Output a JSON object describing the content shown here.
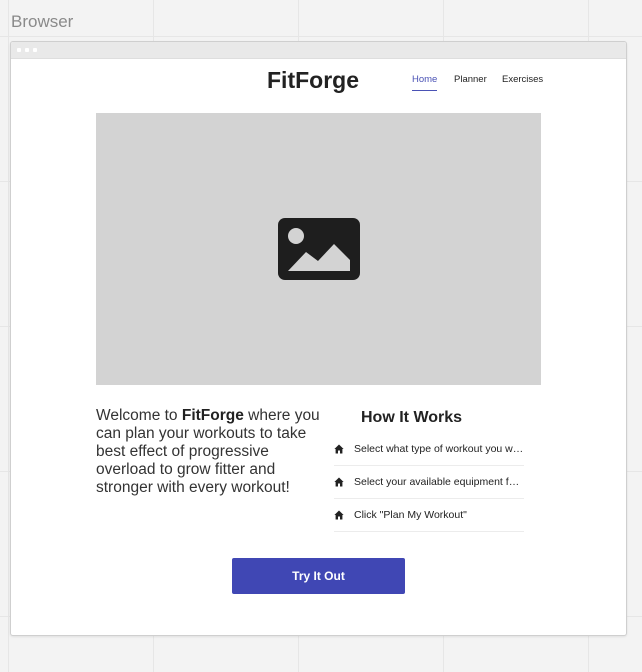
{
  "canvas": {
    "label": "Browser"
  },
  "header": {
    "brand": "FitForge",
    "nav": [
      {
        "label": "Home",
        "active": true
      },
      {
        "label": "Planner",
        "active": false
      },
      {
        "label": "Exercises",
        "active": false
      }
    ]
  },
  "hero": {
    "icon": "image-placeholder-icon"
  },
  "intro": {
    "prefix": "Welcome to ",
    "brand": "FitForge",
    "suffix": " where you can plan your workouts to take best effect of progressive overload to grow fitter and stronger with every workout!"
  },
  "how_it_works": {
    "title": "How It Works",
    "steps": [
      {
        "icon": "home-icon",
        "text": "Select what type of workout you would like"
      },
      {
        "icon": "home-icon",
        "text": "Select your available equipment for the workout"
      },
      {
        "icon": "home-icon",
        "text": "Click \"Plan My Workout\""
      }
    ]
  },
  "cta": {
    "label": "Try It Out"
  },
  "colors": {
    "accent": "#4047b4",
    "nav_active": "#4a52b5",
    "hero_bg": "#d3d3d3"
  }
}
